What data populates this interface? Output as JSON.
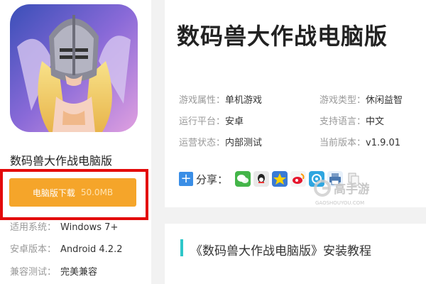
{
  "app": {
    "name": "数码兽大作战电脑版",
    "download_label": "电脑版下载",
    "download_size": "50.0MB",
    "meta": [
      {
        "key": "适用系统：",
        "value": "Windows 7+"
      },
      {
        "key": "安卓版本：",
        "value": "Android 4.2.2"
      },
      {
        "key": "兼容测试：",
        "value": "完美兼容"
      }
    ]
  },
  "detail": {
    "title": "数码兽大作战电脑版",
    "attributes": [
      {
        "key": "游戏属性：",
        "value": "单机游戏"
      },
      {
        "key": "游戏类型：",
        "value": "休闲益智"
      },
      {
        "key": "运行平台：",
        "value": "安卓"
      },
      {
        "key": "支持语言：",
        "value": "中文"
      },
      {
        "key": "运营状态：",
        "value": "内部测试"
      },
      {
        "key": "当前版本：",
        "value": "v1.9.01"
      }
    ],
    "share_label": "分享："
  },
  "watermark": {
    "brand": "高手游",
    "domain": "GAOSHOUYOU.COM"
  },
  "install": {
    "title": "《数码兽大作战电脑版》安装教程"
  },
  "colors": {
    "download": "#f5a52a",
    "highlight_frame": "#e30a0a",
    "accent": "#2ec7c9"
  }
}
